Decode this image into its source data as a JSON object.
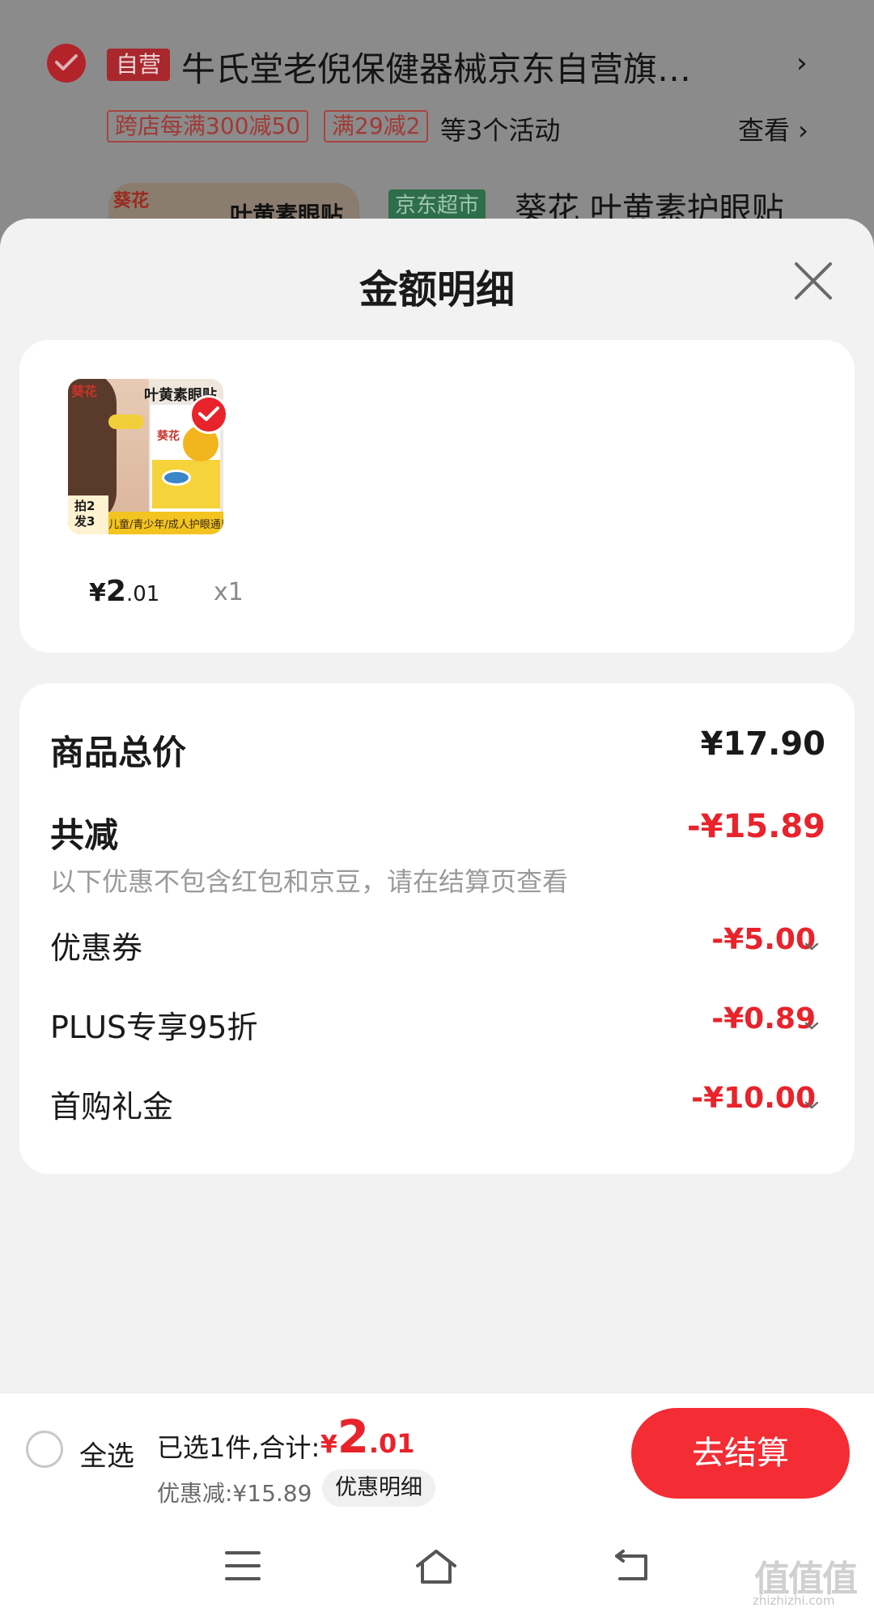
{
  "background": {
    "shop_badge": "自营",
    "shop_name": "牛氏堂老倪保健器械京东自营旗…",
    "shop_arrow": "›",
    "promos": [
      "跨店每满300减50",
      "满29减2"
    ],
    "promo_more": "等3个活动",
    "view_label": "查看 ›",
    "product_thumb_text": "叶黄素眼贴",
    "product_thumb_brand": "葵花",
    "jd_market_badge": "京东超市",
    "product_title": "葵花 叶黄素护眼贴"
  },
  "sheet": {
    "title": "金额明细",
    "product": {
      "image_title": "叶黄素眼贴",
      "image_brand": "葵花",
      "image_brand_small": "葵花",
      "image_corner": "拍2\n发3",
      "image_band": "儿童/青少年/成人护眼通用",
      "price_yen": "¥",
      "price_int": "2",
      "price_dec": ".01",
      "qty": "x1"
    },
    "summary": {
      "total_label": "商品总价",
      "total_value": "¥17.90",
      "reduce_label": "共减",
      "reduce_value": "-¥15.89",
      "note": "以下优惠不包含红包和京豆，请在结算页查看",
      "items": [
        {
          "label": "优惠券",
          "value": "-¥5.00"
        },
        {
          "label": "PLUS专享95折",
          "value": "-¥0.89"
        },
        {
          "label": "首购礼金",
          "value": "-¥10.00"
        }
      ]
    }
  },
  "bottom_bar": {
    "select_all": "全选",
    "selected_text": "已选1件,合计:",
    "total_yen": "¥",
    "total_int": "2",
    "total_dec": ".01",
    "discount_text": "优惠减:¥15.89",
    "detail_pill": "优惠明细",
    "checkout": "去结算"
  },
  "watermark": {
    "text": "值值值",
    "url": "zhizhizhi.com"
  },
  "colors": {
    "accent_red": "#e8232b",
    "checkout_red": "#f42c34",
    "sheet_bg": "#f2f2f2"
  }
}
